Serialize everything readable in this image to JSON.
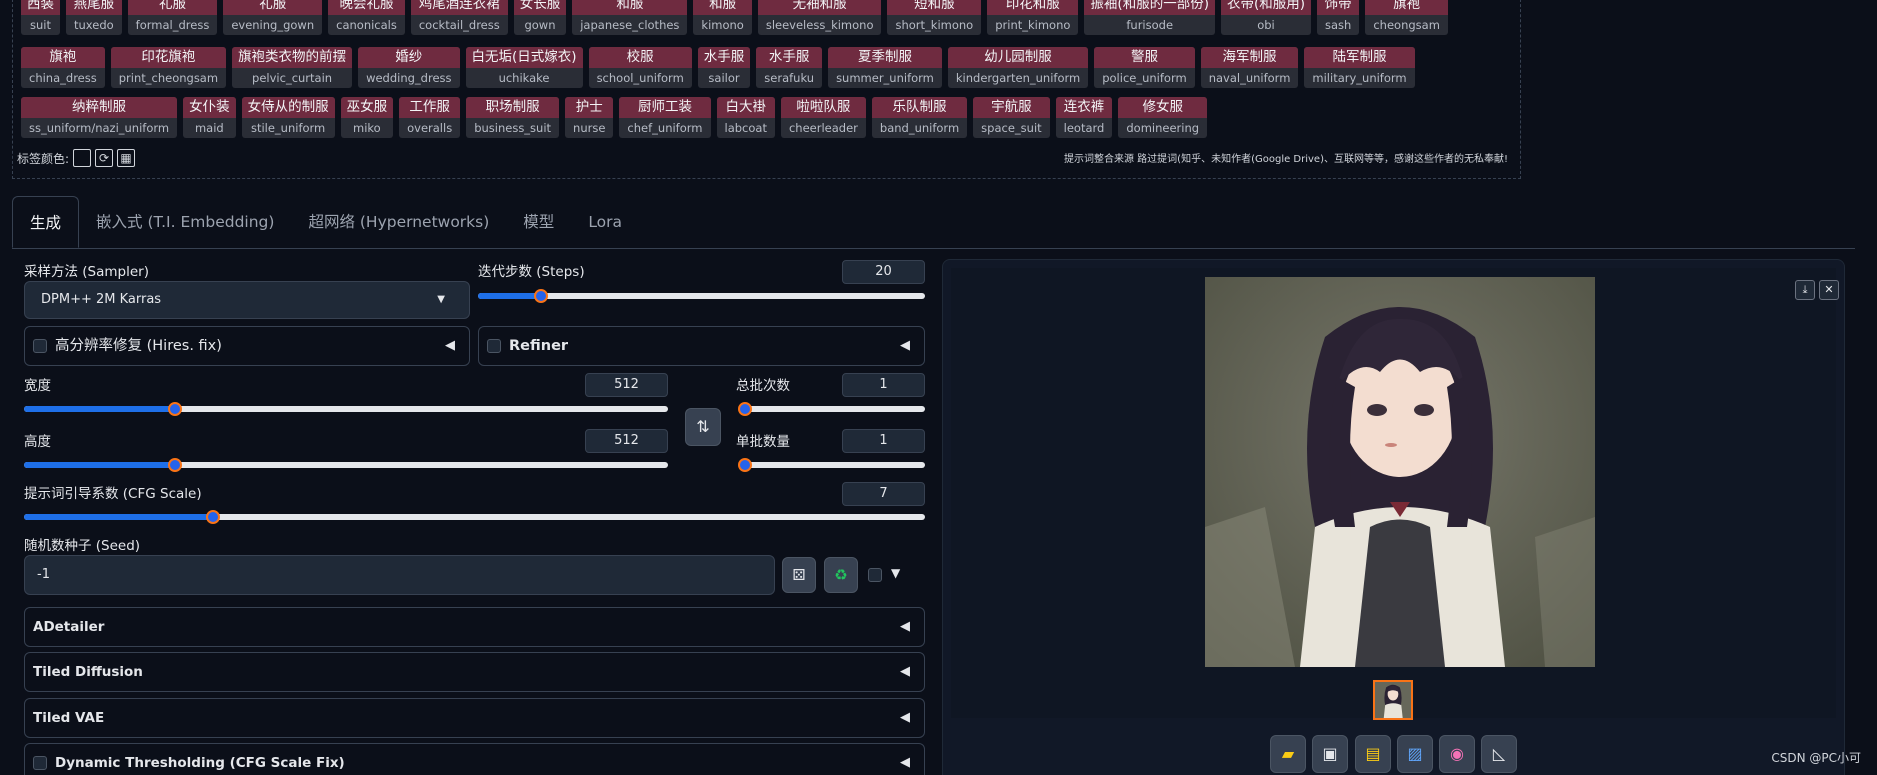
{
  "tag_rows": [
    [
      {
        "zh": "西装",
        "en": "suit"
      },
      {
        "zh": "燕尾服",
        "en": "tuxedo"
      },
      {
        "zh": "礼服",
        "en": "formal_dress"
      },
      {
        "zh": "礼服",
        "en": "evening_gown"
      },
      {
        "zh": "晚会礼服",
        "en": "canonicals"
      },
      {
        "zh": "鸡尾酒连衣裙",
        "en": "cocktail_dress"
      },
      {
        "zh": "女长服",
        "en": "gown"
      },
      {
        "zh": "和服",
        "en": "japanese_clothes"
      },
      {
        "zh": "和服",
        "en": "kimono"
      },
      {
        "zh": "无袖和服",
        "en": "sleeveless_kimono"
      },
      {
        "zh": "短和服",
        "en": "short_kimono"
      },
      {
        "zh": "印花和服",
        "en": "print_kimono"
      },
      {
        "zh": "振袖(和服的一部份)",
        "en": "furisode"
      },
      {
        "zh": "衣带(和服用)",
        "en": "obi"
      },
      {
        "zh": "饰带",
        "en": "sash"
      },
      {
        "zh": "旗袍",
        "en": "cheongsam"
      }
    ],
    [
      {
        "zh": "旗袍",
        "en": "china_dress"
      },
      {
        "zh": "印花旗袍",
        "en": "print_cheongsam"
      },
      {
        "zh": "旗袍类衣物的前摆",
        "en": "pelvic_curtain"
      },
      {
        "zh": "婚纱",
        "en": "wedding_dress"
      },
      {
        "zh": "白无垢(日式嫁衣)",
        "en": "uchikake"
      },
      {
        "zh": "校服",
        "en": "school_uniform"
      },
      {
        "zh": "水手服",
        "en": "sailor"
      },
      {
        "zh": "水手服",
        "en": "serafuku"
      },
      {
        "zh": "夏季制服",
        "en": "summer_uniform"
      },
      {
        "zh": "幼儿园制服",
        "en": "kindergarten_uniform"
      },
      {
        "zh": "警服",
        "en": "police_uniform"
      },
      {
        "zh": "海军制服",
        "en": "naval_uniform"
      },
      {
        "zh": "陆军制服",
        "en": "military_uniform"
      }
    ],
    [
      {
        "zh": "纳粹制服",
        "en": "ss_uniform/nazi_uniform"
      },
      {
        "zh": "女仆装",
        "en": "maid"
      },
      {
        "zh": "女侍从的制服",
        "en": "stile_uniform"
      },
      {
        "zh": "巫女服",
        "en": "miko"
      },
      {
        "zh": "工作服",
        "en": "overalls"
      },
      {
        "zh": "职场制服",
        "en": "business_suit"
      },
      {
        "zh": "护士",
        "en": "nurse"
      },
      {
        "zh": "厨师工装",
        "en": "chef_uniform"
      },
      {
        "zh": "白大褂",
        "en": "labcoat"
      },
      {
        "zh": "啦啦队服",
        "en": "cheerleader"
      },
      {
        "zh": "乐队制服",
        "en": "band_uniform"
      },
      {
        "zh": "宇航服",
        "en": "space_suit"
      },
      {
        "zh": "连衣裤",
        "en": "leotard"
      },
      {
        "zh": "修女服",
        "en": "domineering"
      }
    ]
  ],
  "tag_color_label": "标签颜色:",
  "credits": "提示词整合来源 路过提词(知乎、未知作者(Google Drive)、互联网等等，感谢这些作者的无私奉献!",
  "tabs": [
    "生成",
    "嵌入式 (T.I. Embedding)",
    "超网络 (Hypernetworks)",
    "模型",
    "Lora"
  ],
  "sampler": {
    "label": "采样方法 (Sampler)",
    "value": "DPM++ 2M Karras"
  },
  "steps": {
    "label": "迭代步数 (Steps)",
    "value": "20",
    "fraction": 0.14
  },
  "hires_fix": {
    "label": "高分辨率修复 (Hires. fix)"
  },
  "refiner": {
    "label": "Refiner"
  },
  "width": {
    "label": "宽度",
    "value": "512",
    "fraction": 0.234
  },
  "height": {
    "label": "高度",
    "value": "512",
    "fraction": 0.234
  },
  "batch_count": {
    "label": "总批次数",
    "value": "1",
    "fraction": 0.0
  },
  "batch_size": {
    "label": "单批数量",
    "value": "1",
    "fraction": 0.0
  },
  "cfg": {
    "label": "提示词引导系数 (CFG Scale)",
    "value": "7",
    "fraction": 0.21
  },
  "seed": {
    "label": "随机数种子 (Seed)",
    "value": "-1"
  },
  "accordions": [
    "ADetailer",
    "Tiled Diffusion",
    "Tiled VAE",
    "Dynamic Thresholding (CFG Scale Fix)"
  ],
  "icons": {
    "swap": "swap-icon",
    "dice": "dice-icon",
    "recycle": "recycle-icon",
    "download": "download-icon",
    "close": "close-icon",
    "folder": "folder-icon",
    "save": "save-icon",
    "zip": "zip-icon",
    "img2img": "image-icon",
    "inpaint": "palette-icon",
    "extras": "ruler-icon"
  },
  "watermark": "CSDN @PC小可",
  "colors": {
    "accent": "#2563eb",
    "tag_bg": "#6f2b40",
    "bg": "#0b0f19"
  }
}
